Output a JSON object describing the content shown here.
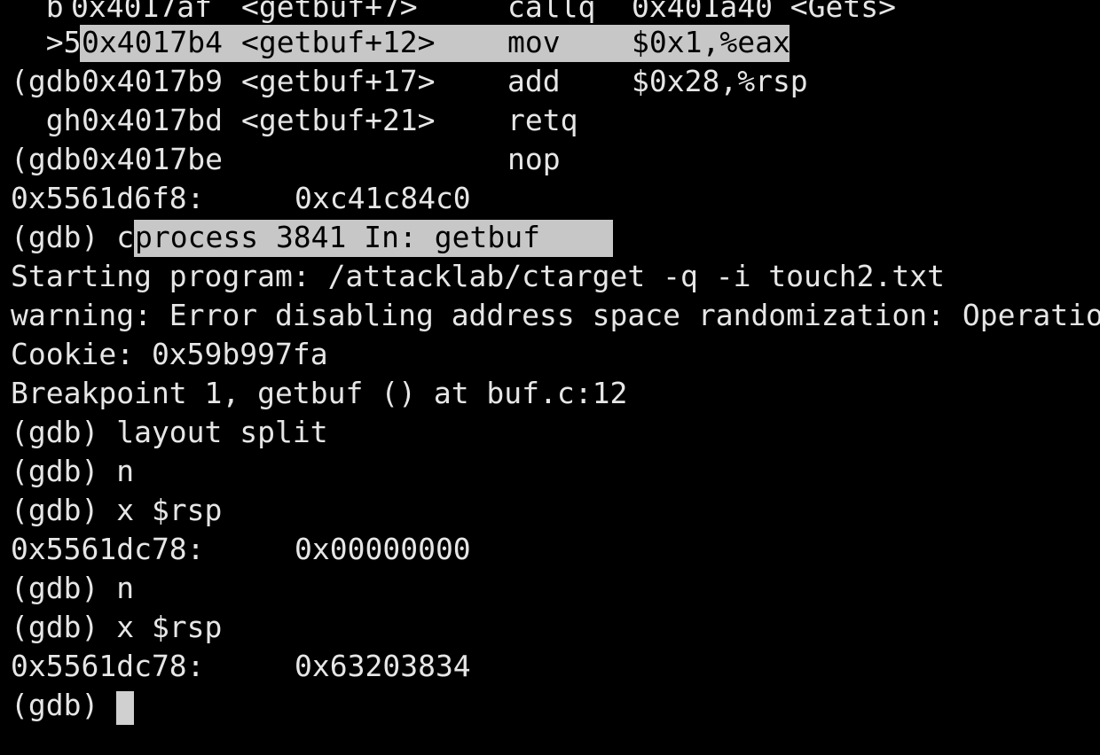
{
  "colors": {
    "background": "#000000",
    "foreground": "#e6e6e6",
    "highlight_bg": "#c7c7c7",
    "highlight_fg": "#000000",
    "cursor": "#d0d0d0"
  },
  "asm_window": {
    "rows": [
      {
        "prefix": "  b",
        "addr": "0x4017af",
        "sym": "<getbuf+7>",
        "op": "callq",
        "args": "0x401a40 <Gets>"
      },
      {
        "prefix": "  >5",
        "addr": "0x4017b4",
        "sym": "<getbuf+12>",
        "op": "mov",
        "args": "$0x1,%eax"
      },
      {
        "prefix": "(gdb",
        "addr": "0x4017b9",
        "sym": "<getbuf+17>",
        "op": "add",
        "args": "$0x28,%rsp"
      },
      {
        "prefix": "  gh",
        "addr": "0x4017bd",
        "sym": "<getbuf+21>",
        "op": "retq",
        "args": ""
      },
      {
        "prefix": "(gdb",
        "addr": "0x4017be",
        "sym": "",
        "op": "nop",
        "args": ""
      }
    ]
  },
  "status_line": {
    "prefix": "(gdb) c",
    "text": "process 3841 In: getbuf"
  },
  "console": {
    "mem_line_0_addr": "0x5561d6f8:",
    "mem_line_0_val": "0xc41c84c0",
    "line_start": "Starting program: /attacklab/ctarget -q -i touch2.txt",
    "line_warning": "warning: Error disabling address space randomization: Operation not permitted",
    "line_cookie": "Cookie: 0x59b997fa",
    "line_breakpoint": "Breakpoint 1, getbuf () at buf.c:12",
    "line_layout": "(gdb) layout split",
    "line_n1": "(gdb) n",
    "line_x1": "(gdb) x $rsp",
    "mem_line_1_addr": "0x5561dc78:",
    "mem_line_1_val": "0x00000000",
    "line_n2": "(gdb) n",
    "line_x2": "(gdb) x $rsp",
    "mem_line_2_addr": "0x5561dc78:",
    "mem_line_2_val": "0x63203834",
    "prompt": "(gdb) "
  }
}
